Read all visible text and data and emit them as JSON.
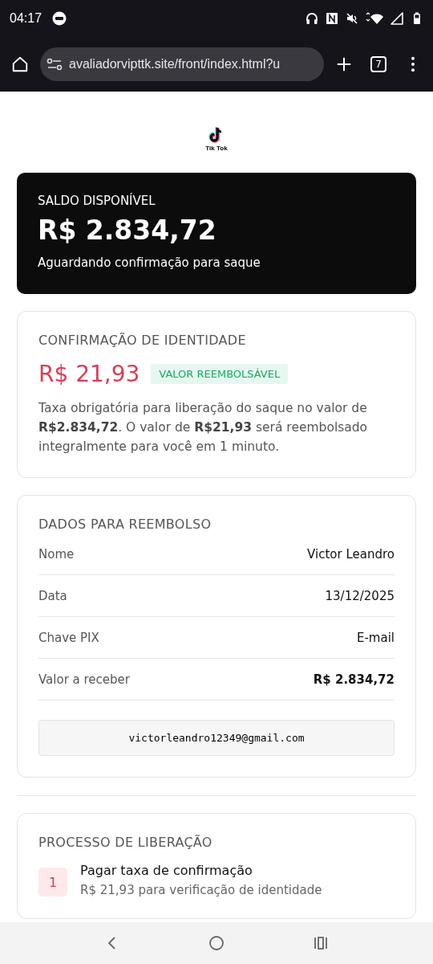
{
  "status_bar": {
    "time": "04:17"
  },
  "browser": {
    "url": "avaliadorvipttk.site/front/index.html?u",
    "tab_count": "7"
  },
  "logo": {
    "caption": "Tik Tok"
  },
  "balance": {
    "label": "SALDO DISPONÍVEL",
    "amount": "R$ 2.834,72",
    "note": "Aguardando confirmação para saque"
  },
  "identity": {
    "title": "CONFIRMAÇÃO DE IDENTIDADE",
    "amount": "R$ 21,93",
    "badge": "VALOR REEMBOLSÁVEL",
    "text": "Taxa obrigatória para liberação do saque no valor de **R$2.834,72**. O valor de **R$21,93** será reembolsado integralmente para você em 1 minuto."
  },
  "refund": {
    "title": "DADOS PARA REEMBOLSO",
    "rows": [
      {
        "label": "Nome",
        "value": "Victor Leandro",
        "bold": false
      },
      {
        "label": "Data",
        "value": "13/12/2025",
        "bold": false
      },
      {
        "label": "Chave PIX",
        "value": "E-mail",
        "bold": false
      },
      {
        "label": "Valor a receber",
        "value": "R$ 2.834,72",
        "bold": true
      }
    ],
    "pix_key": "victorleandro12349@gmail.com"
  },
  "process": {
    "title": "PROCESSO DE LIBERAÇÃO",
    "steps": [
      {
        "number": "1",
        "title": "Pagar taxa de confirmação",
        "subtitle": "R$ 21,93 para verificação de identidade"
      }
    ]
  }
}
